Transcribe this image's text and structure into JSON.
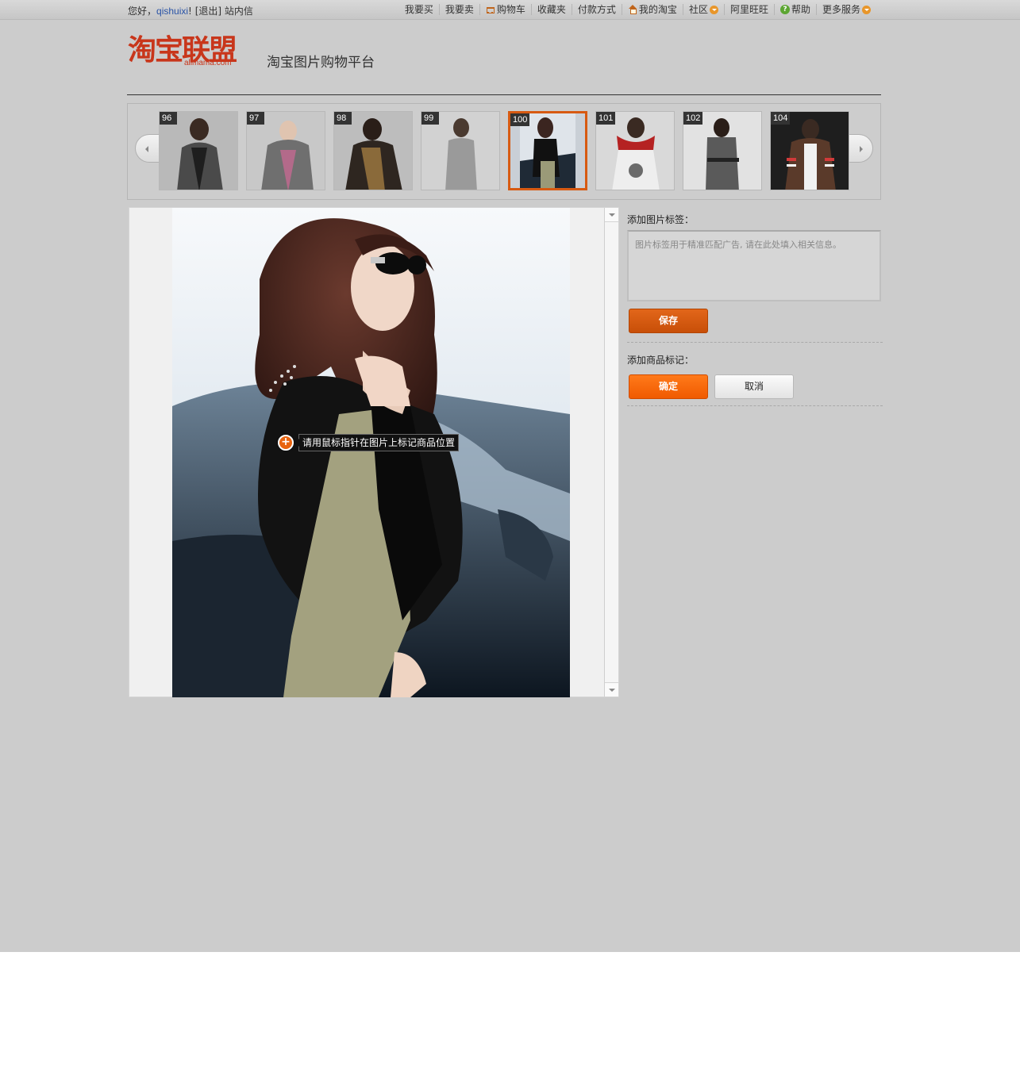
{
  "topbar": {
    "greeting": "您好，",
    "username": "qishuixi",
    "user_mark": "!",
    "logout": "[退出]",
    "messages": "站内信",
    "nav": [
      {
        "label": "我要买",
        "icon": ""
      },
      {
        "label": "我要卖",
        "icon": ""
      },
      {
        "label": "购物车",
        "icon": "cart-icon"
      },
      {
        "label": "收藏夹",
        "icon": ""
      },
      {
        "label": "付款方式",
        "icon": ""
      },
      {
        "label": "我的淘宝",
        "icon": "home-icon"
      },
      {
        "label": "社区",
        "icon": "chevron-down-icon"
      },
      {
        "label": "阿里旺旺",
        "icon": ""
      },
      {
        "label": "帮助",
        "icon": "help-icon"
      },
      {
        "label": "更多服务",
        "icon": "chevron-down-icon"
      }
    ]
  },
  "header": {
    "logo_text": "淘宝联盟",
    "logo_sub": "alimama.com",
    "platform_title": "淘宝图片购物平台"
  },
  "carousel": {
    "thumbnails": [
      {
        "num": "96",
        "selected": false
      },
      {
        "num": "97",
        "selected": false
      },
      {
        "num": "98",
        "selected": false
      },
      {
        "num": "99",
        "selected": false
      },
      {
        "num": "100",
        "selected": true
      },
      {
        "num": "101",
        "selected": false
      },
      {
        "num": "102",
        "selected": false
      },
      {
        "num": "104",
        "selected": false
      }
    ]
  },
  "image_panel": {
    "marker_tip": "请用鼠标指针在图片上标记商品位置",
    "marker_symbol": "+"
  },
  "right_panel": {
    "tag_label": "添加图片标签：",
    "tag_placeholder": "图片标签用于精准匹配广告, 请在此处填入相关信息。",
    "save_button": "保存",
    "product_label": "添加商品标记：",
    "confirm_button": "确定",
    "cancel_button": "取消"
  },
  "colors": {
    "accent": "#d75a12",
    "background": "#cccccc",
    "link": "#2953a6"
  }
}
